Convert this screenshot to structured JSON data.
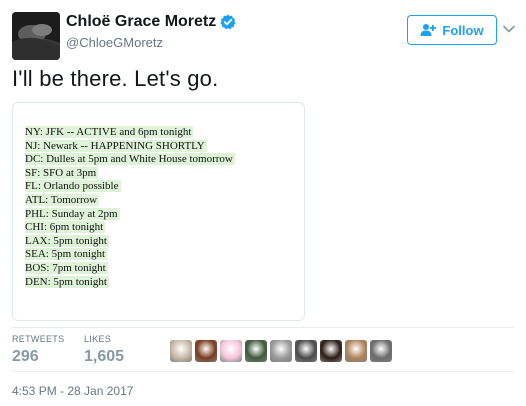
{
  "author": {
    "display_name": "Chloë Grace Moretz",
    "handle": "@ChloeGMoretz",
    "verified": true,
    "avatar_icon": "profile-photo"
  },
  "actions": {
    "follow_label": "Follow",
    "follow_icon": "add-user-icon",
    "menu_icon": "chevron-down-icon",
    "accent_color": "#1da1f2"
  },
  "tweet": {
    "text": "I'll be there. Let's go."
  },
  "media": {
    "lines": [
      "NY: JFK -- ACTIVE and 6pm tonight",
      "NJ: Newark -- HAPPENING SHORTLY",
      "DC: Dulles at 5pm and White House tomorrow",
      "SF: SFO at 3pm",
      "FL: Orlando possible",
      "ATL: Tomorrow",
      "PHL: Sunday at 2pm",
      "CHI: 6pm tonight",
      "LAX: 5pm tonight",
      "SEA: 5pm tonight",
      "BOS: 7pm tonight",
      "DEN: 5pm tonight"
    ],
    "highlight_color": "#dff3d9"
  },
  "stats": {
    "retweets_label": "RETWEETS",
    "retweets_value": "296",
    "likes_label": "LIKES",
    "likes_value": "1,605"
  },
  "likers": [
    {
      "icon": "liker-avatar-1",
      "color": "#c9b8a8"
    },
    {
      "icon": "liker-avatar-2",
      "color": "#7a3b1d"
    },
    {
      "icon": "liker-avatar-3",
      "color": "#f5c6d8"
    },
    {
      "icon": "liker-avatar-4",
      "color": "#3d5a3a"
    },
    {
      "icon": "liker-avatar-5",
      "color": "#9a9a9a"
    },
    {
      "icon": "liker-avatar-6",
      "color": "#4a4a4a"
    },
    {
      "icon": "liker-avatar-7",
      "color": "#2b1a14"
    },
    {
      "icon": "liker-avatar-8",
      "color": "#b0835a"
    },
    {
      "icon": "liker-avatar-9",
      "color": "#6b6b6b"
    }
  ],
  "timestamp": "4:53 PM - 28 Jan 2017"
}
